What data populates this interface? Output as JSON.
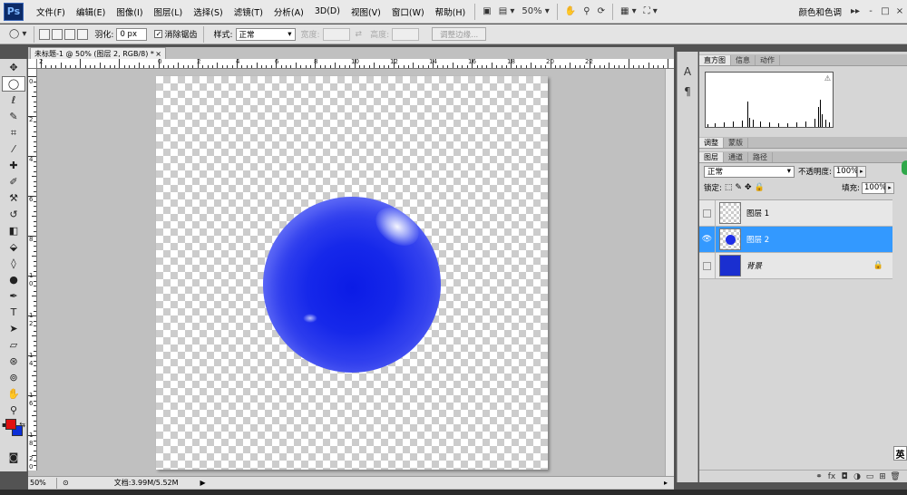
{
  "app": {
    "logo": "Ps",
    "workspace": "颜色和色调"
  },
  "menus": [
    "文件(F)",
    "编辑(E)",
    "图像(I)",
    "图层(L)",
    "选择(S)",
    "滤镜(T)",
    "分析(A)",
    "3D(D)",
    "视图(V)",
    "窗口(W)",
    "帮助(H)"
  ],
  "menubar": {
    "zoom": "50%",
    "window_controls": [
      "-",
      "□",
      "×"
    ]
  },
  "options": {
    "feather_label": "羽化:",
    "feather_value": "0 px",
    "antialias_label": "消除锯齿",
    "style_label": "样式:",
    "style_value": "正常",
    "width_label": "宽度:",
    "height_label": "高度:",
    "refine_edge": "调整边缘..."
  },
  "document": {
    "tab_title": "未标题-1 @ 50% (图层 2, RGB/8) *",
    "close": "×",
    "ruler_top_labels": [
      "2",
      "0",
      "2",
      "4",
      "6",
      "8",
      "10",
      "12",
      "14",
      "16",
      "18",
      "20",
      "22"
    ],
    "ruler_left_labels": [
      "0",
      "2",
      "4",
      "6",
      "8",
      "1",
      "0",
      "1",
      "2",
      "1",
      "4",
      "1",
      "6",
      "1",
      "8",
      "2",
      "0"
    ]
  },
  "status": {
    "zoom": "50%",
    "doc_info": "文档:3.99M/5.52M",
    "arrow": "▶"
  },
  "panels": {
    "top_tabs": [
      "直方图",
      "信息",
      "动作"
    ],
    "hist_warning": "⚠",
    "adjust_tabs": [
      "调整",
      "蒙版"
    ],
    "layer_tabs": [
      "图层",
      "通道",
      "路径"
    ],
    "blend_mode": "正常",
    "opacity_label": "不透明度:",
    "opacity_value": "100%",
    "lock_label": "锁定:",
    "fill_label": "填充:",
    "fill_value": "100%"
  },
  "layers": [
    {
      "name": "图层 1",
      "visible": false,
      "selected": false
    },
    {
      "name": "图层 2",
      "visible": true,
      "selected": true
    },
    {
      "name": "背景",
      "visible": false,
      "selected": false,
      "locked": true
    }
  ],
  "ime": "英",
  "colors": {
    "foreground": "#e01010",
    "background": "#0c2fd8",
    "selection": "#3399ff",
    "sphere": "#1628ea"
  }
}
